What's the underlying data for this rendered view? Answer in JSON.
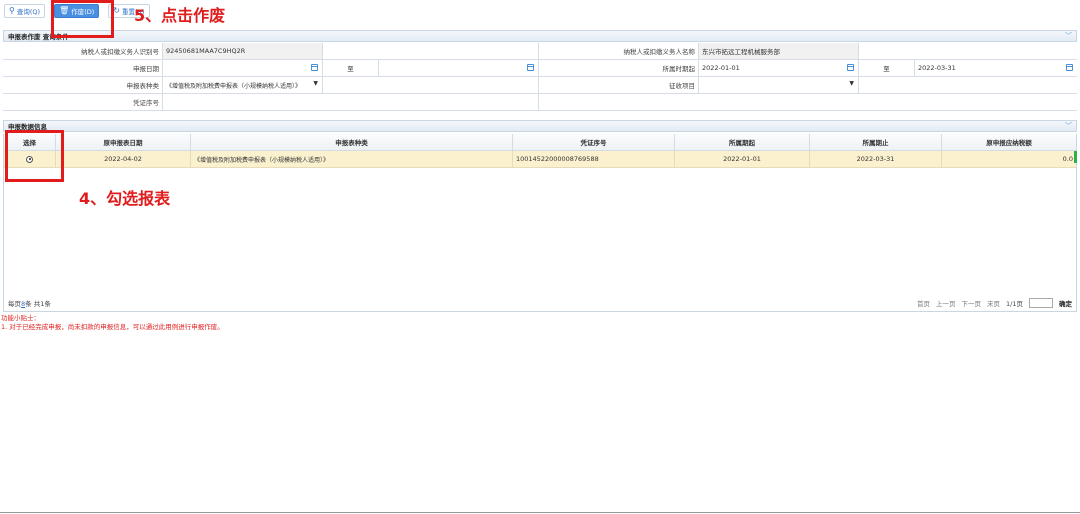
{
  "toolbar": {
    "query_label": "查询(Q)",
    "void_label": "作废(D)",
    "reset_label": "重置(R)"
  },
  "query_section": {
    "title": "申报表作废 查询条件"
  },
  "form": {
    "taxpayer_id_label": "纳税人或扣缴义务人识别号",
    "taxpayer_id_value": "92450681MAA7C9HQ2R",
    "taxpayer_name_label": "纳税人或扣缴义务人名称",
    "taxpayer_name_value": "东兴市拓远工程机械服务部",
    "declare_date_label": "申报日期",
    "declare_date_from": "",
    "to_label": "至",
    "declare_date_to": "",
    "period_start_label": "所属时期起",
    "period_start_value": "2022-01-01",
    "period_to_label": "至",
    "period_end_value": "2022-03-31",
    "form_type_label": "申报表种类",
    "form_type_value": "《增值税及附加税费申报表（小规模纳税人适用）》",
    "levy_item_label": "征收项目",
    "levy_item_value": "",
    "voucher_no_label": "凭证序号",
    "voucher_no_value": ""
  },
  "data_section": {
    "title": "申报数据信息"
  },
  "grid": {
    "columns": [
      "选择",
      "原申报表日期",
      "申报表种类",
      "凭证序号",
      "所属期起",
      "所属期止",
      "原申报应纳税额"
    ],
    "rows": [
      {
        "date": "2022-04-02",
        "form_type": "《增值税及附加税费申报表（小规模纳税人适用）》",
        "voucher": "10014522000008769588",
        "period_start": "2022-01-01",
        "period_end": "2022-03-31",
        "tax": "0.0"
      }
    ]
  },
  "pager": {
    "per_page_prefix": "每页",
    "per_page_value": "8",
    "per_page_suffix": "条 共1条",
    "first": "首页",
    "prev": "上一页",
    "next": "下一页",
    "last": "末页",
    "page_info": "1/1页",
    "confirm": "确定"
  },
  "tips": {
    "title": "功能小贴士：",
    "line1": "1. 对于已经完成申报，尚未扣款的申报信息，可以通过此用例进行申报作废。"
  },
  "annotations": {
    "step4": "4、勾选报表",
    "step5": "5、点击作废"
  },
  "colors": {
    "highlight_row": "#fbf1cf",
    "annotation_red": "#e01c1c",
    "primary_button": "#4a90e2"
  }
}
